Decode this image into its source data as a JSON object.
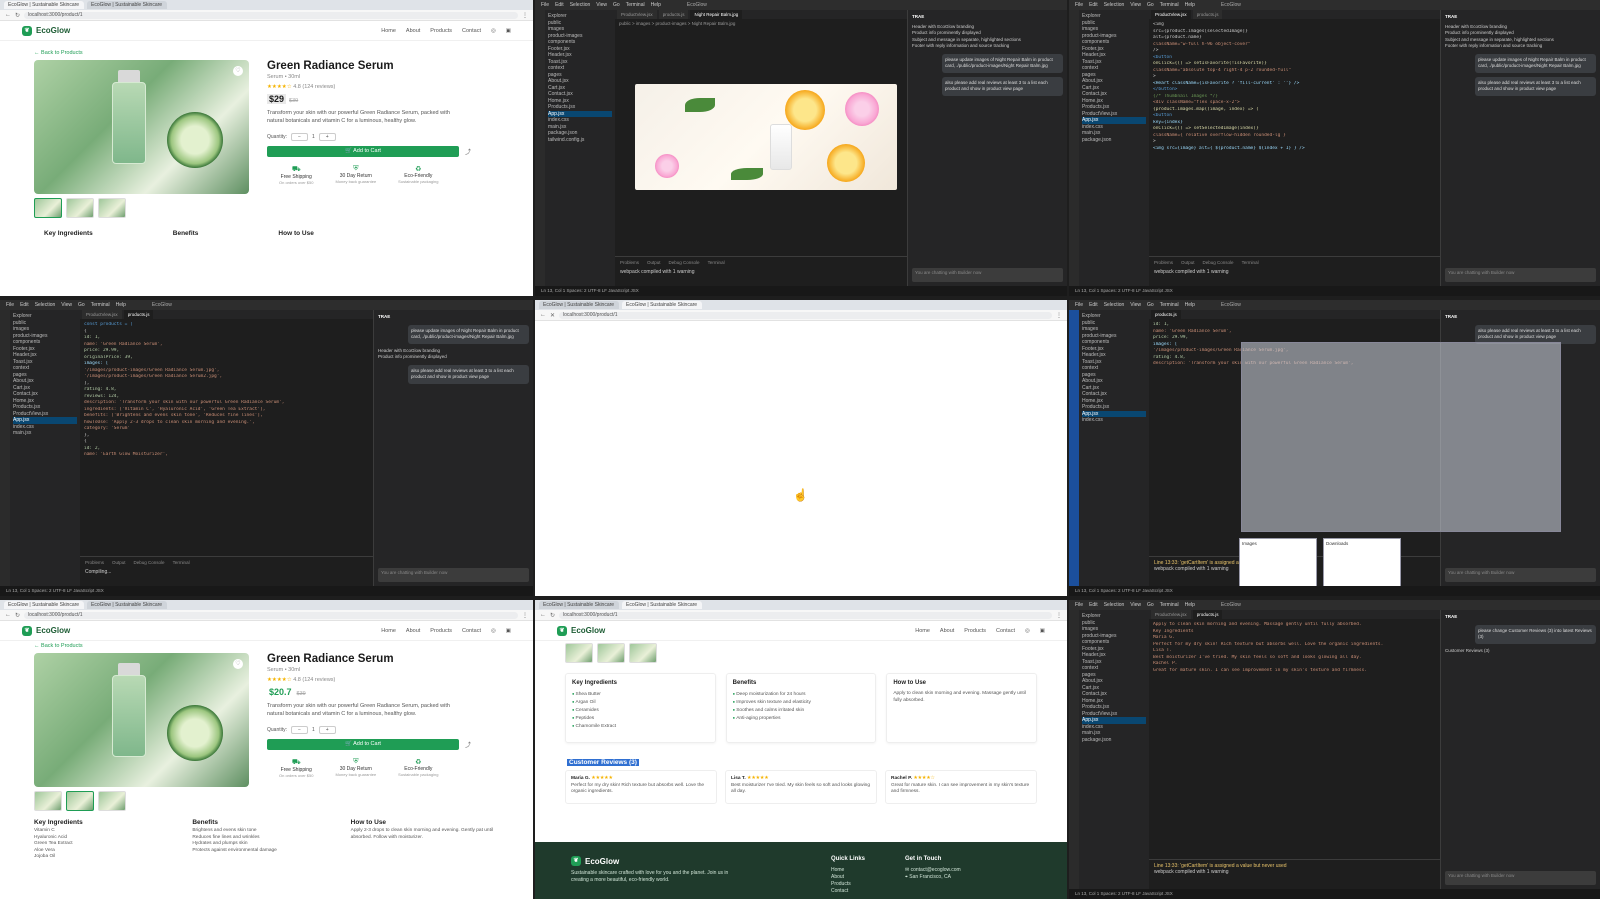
{
  "browser": {
    "tab_label": "EcoGlow | Sustainable Skincare",
    "url": "localhost:3000/product/1"
  },
  "site": {
    "brand": "EcoGlow",
    "nav": [
      "Home",
      "About",
      "Products",
      "Contact"
    ],
    "back_link": "Back to Products"
  },
  "product": {
    "name": "Green Radiance Serum",
    "subtitle": "Serum • 30ml",
    "stars": "★★★★☆",
    "rating_text": "4.8 (124 reviews)",
    "price_before": "$29",
    "price_after": "$20.7",
    "old_price": "$39",
    "description": "Transform your skin with our powerful Green Radiance Serum, packed with natural botanicals and vitamin C for a luminous, healthy glow.",
    "quantity_label": "Quantity:",
    "quantity_value": "1",
    "add_to_cart": "Add to Cart",
    "features": [
      {
        "title": "Free Shipping",
        "sub": "On orders over $50"
      },
      {
        "title": "30 Day Return",
        "sub": "Money back guarantee"
      },
      {
        "title": "Eco-Friendly",
        "sub": "Sustainable packaging"
      }
    ],
    "tabs": [
      "Key Ingredients",
      "Benefits",
      "How to Use"
    ]
  },
  "details": {
    "ingredients_title": "Key Ingredients",
    "ingredients": [
      "Shea Butter",
      "Argan Oil",
      "Ceramides",
      "Peptides",
      "Chamomile Extract"
    ],
    "benefits_title": "Benefits",
    "benefits": [
      "Deep moisturization for 24 hours",
      "Improves skin texture and elasticity",
      "Soothes and calms irritated skin",
      "Anti-aging properties"
    ],
    "howto_title": "How to Use",
    "howto": "Apply to clean skin morning and evening. Massage gently until fully absorbed.",
    "ingredients_b": [
      "Vitamin C",
      "Hyaluronic Acid",
      "Green Tea Extract",
      "Aloe Vera",
      "Jojoba Oil"
    ],
    "benefits_b": [
      "Brightens and evens skin tone",
      "Reduces fine lines and wrinkles",
      "Hydrates and plumps skin",
      "Protects against environmental damage"
    ],
    "howto_b": "Apply 2-3 drops to clean skin morning and evening. Gently pat until absorbed. Follow with moisturizer."
  },
  "reviews": {
    "title": "Customer Reviews (3)",
    "items": [
      {
        "name": "Maria G.",
        "stars": "★★★★★",
        "text": "Perfect for my dry skin! Rich texture but absorbs well. Love the organic ingredients."
      },
      {
        "name": "Lisa T.",
        "stars": "★★★★★",
        "text": "Best moisturizer I've tried. My skin feels so soft and looks glowing all day."
      },
      {
        "name": "Rachel P.",
        "stars": "★★★★☆",
        "text": "Great for mature skin. I can see improvement in my skin's texture and firmness."
      }
    ]
  },
  "footer": {
    "tagline": "Sustainable skincare crafted with love for you and the planet. Join us in creating a more beautiful, eco-friendly world.",
    "links_title": "Quick Links",
    "links": [
      "Home",
      "About",
      "Products",
      "Contact"
    ],
    "contact_title": "Get in Touch",
    "email": "contact@ecoglow.com",
    "location": "San Francisco, CA"
  },
  "vscode": {
    "menu": [
      "File",
      "Edit",
      "Selection",
      "View",
      "Go",
      "Terminal",
      "Help"
    ],
    "window_title": "EcoGlow",
    "explorer_title": "Explorer",
    "files": [
      "public",
      "images",
      "product-images",
      "components",
      "Footer.jsx",
      "Header.jsx",
      "Toast.jsx",
      "context",
      "pages",
      "About.jsx",
      "Cart.jsx",
      "Contact.jsx",
      "Home.jsx",
      "Products.jsx",
      "ProductView.jsx",
      "App.jsx",
      "index.css",
      "main.jsx",
      "package.json",
      "tailwind.config.js"
    ],
    "active_file": "ProductView.jsx",
    "editor_tabs": [
      "ProductView.jsx",
      "products.js",
      "Night Repair Balm.jpg"
    ],
    "terminal_tabs": [
      "Problems",
      "Output",
      "Debug Console",
      "Terminal"
    ],
    "terminal_text": "webpack compiled with 1 warning",
    "terminal_compiling": "Compiling...",
    "chat_title": "TRAE",
    "chat_items": [
      "Header with EcoGlow branding",
      "Product info prominently displayed",
      "Subject and message in separate, highlighted sections",
      "Footer with reply information and source tracking"
    ],
    "chat_prompt": "please update images of Night Repair Balm in product card, ./public/product-images/Night Repair Balm.jpg",
    "chat_prompt2": "also please add real reviews at least 3 to a list each product and show in product view page",
    "chat_prompt3": "please change Customer Reviews (3) into latest Reviews (3)",
    "chat_placeholder": "You are chatting with Builder now",
    "status_text": "Ln 13, Col 1  Spaces: 2  UTF-8  LF  JavaScript JSX",
    "notice": "Line 13:33: 'getCartItem' is assigned a value but never used",
    "code_lines": [
      "const products = [",
      "  {",
      "    id: 1,",
      "    name: 'Green Radiance Serum',",
      "    price: 29.99,",
      "    originalPrice: 39,",
      "    images: [",
      "      '/images/product-images/Green Radiance Serum.jpg',",
      "      '/images/product-images/Green Radiance Serum2.jpg',",
      "    ],",
      "    rating: 4.8,",
      "    reviews: 124,",
      "    description: 'Transform your skin with our powerful Green Radiance Serum',",
      "    ingredients: ['Vitamin C', 'Hyaluronic Acid', 'Green Tea Extract'],",
      "    benefits: ['Brightens and evens skin tone', 'Reduces fine lines'],",
      "    howToUse: 'Apply 2-3 drops to clean skin morning and evening.',",
      "    category: 'Serum'",
      "  },",
      "  {",
      "    id: 2,",
      "    name: 'Earth Glow Moisturizer',"
    ],
    "code_lines_b": [
      "<img",
      "  src={product.images[selectedImage]}",
      "  alt={product.name}",
      "  className=\"w-full h-96 object-cover\"",
      "/>",
      "<button",
      "  onClick={() => setIsFavorite(!isFavorite)}",
      "  className=\"absolute top-4 right-4 p-2 rounded-full\"",
      ">",
      "  <Heart className={isFavorite ? 'fill-current' : ''} />",
      "</button>",
      "{/* Thumbnail Images */}",
      "<div className=\"flex space-x-2\">",
      "  {product.images.map((image, index) => (",
      "    <button",
      "      key={index}",
      "      onClick={() => setSelectedImage(index)}",
      "      className={`relative overflow-hidden rounded-lg`}",
      "    >",
      "      <img src={image} alt={`${product.name} ${index + 1}`} />"
    ]
  },
  "image_viewer": {
    "path": "public > images > product-images > Night Repair Balm.jpg"
  },
  "popups": [
    "Images",
    "Downloads"
  ]
}
